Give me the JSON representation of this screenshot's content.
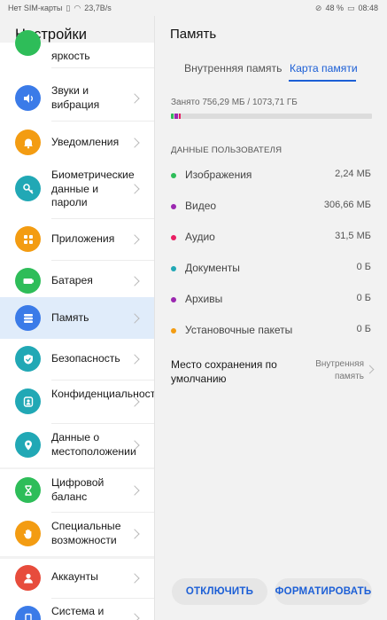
{
  "status": {
    "sim": "Нет SIM-карты",
    "speed": "23,7B/s",
    "battery": "48 %",
    "time": "08:48"
  },
  "left": {
    "title": "Настройки",
    "items": [
      {
        "label": "яркость",
        "color": "#2ebd59"
      },
      {
        "label": "Звуки и вибрация",
        "color": "#3b7be8"
      },
      {
        "label": "Уведомления",
        "color": "#f39c12"
      },
      {
        "label": "Биометрические данные и пароли",
        "color": "#21a8b5"
      },
      {
        "label": "Приложения",
        "color": "#f39c12"
      },
      {
        "label": "Батарея",
        "color": "#2ebd59"
      },
      {
        "label": "Память",
        "color": "#3b7be8"
      },
      {
        "label": "Безопасность",
        "color": "#21a8b5"
      },
      {
        "label": "Конфиденциальность",
        "color": "#21a8b5"
      },
      {
        "label": "Данные о местоположении",
        "color": "#21a8b5"
      },
      {
        "label": "Цифровой баланс",
        "color": "#2ebd59"
      },
      {
        "label": "Специальные возможности",
        "color": "#f39c12"
      },
      {
        "label": "Аккаунты",
        "color": "#e74c3c"
      },
      {
        "label": "Система и",
        "color": "#3b7be8"
      }
    ]
  },
  "right": {
    "title": "Память",
    "tabs": [
      "Внутренняя память",
      "Карта памяти"
    ],
    "used": "Занято 756,29 МБ / 1073,71 ГБ",
    "bar": [
      {
        "fraction": 0.012,
        "color": "#2ebd59"
      },
      {
        "fraction": 0.018,
        "color": "#9b27b0"
      },
      {
        "fraction": 0.01,
        "color": "#e91e63"
      }
    ],
    "section": "ДАННЫЕ ПОЛЬЗОВАТЕЛЯ",
    "rows": [
      {
        "name": "Изображения",
        "value": "2,24 МБ",
        "color": "#2ebd59"
      },
      {
        "name": "Видео",
        "value": "306,66 МБ",
        "color": "#9b27b0"
      },
      {
        "name": "Аудио",
        "value": "31,5 МБ",
        "color": "#e91e63"
      },
      {
        "name": "Документы",
        "value": "0 Б",
        "color": "#21a8b5"
      },
      {
        "name": "Архивы",
        "value": "0 Б",
        "color": "#9b27b0"
      },
      {
        "name": "Установочные пакеты",
        "value": "0 Б",
        "color": "#f39c12"
      }
    ],
    "location_label": "Место сохранения по умолчанию",
    "location_value": "Внутренняя память",
    "btn_disable": "ОТКЛЮЧИТЬ",
    "btn_format": "ФОРМАТИРОВАТЬ"
  }
}
